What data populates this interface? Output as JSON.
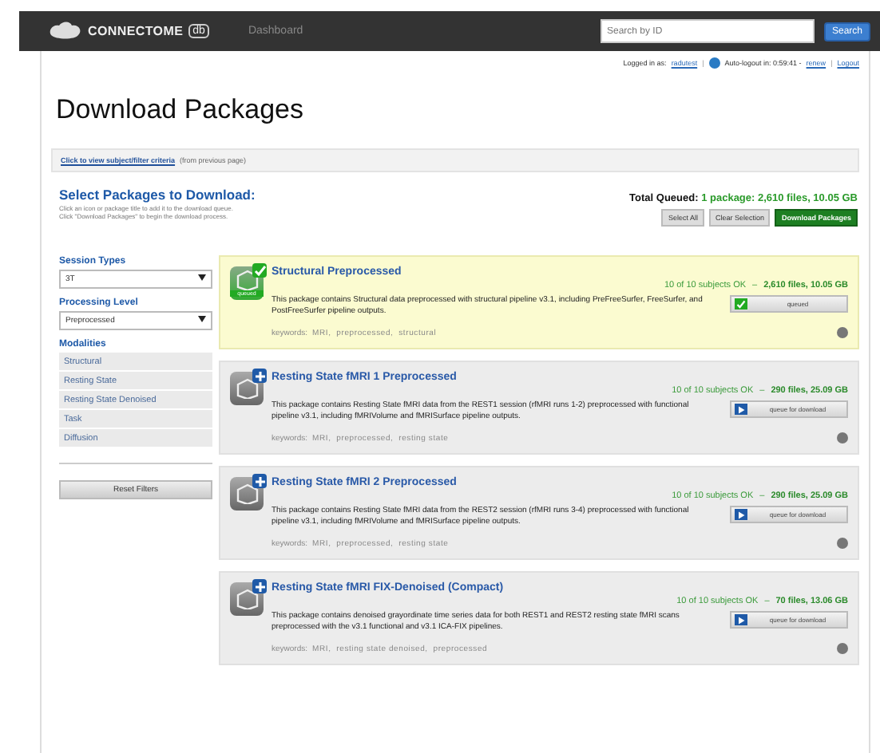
{
  "nav": {
    "logo": "CONNECTOME",
    "logo_badge": "db",
    "link": "Dashboard",
    "search": {
      "placeholder": "Search by ID"
    },
    "search_button": "Search"
  },
  "session": {
    "logged_in_label": "Logged in as:",
    "user": "radutest",
    "separator_1": "|",
    "separator_2": "|",
    "auto_logout": "Auto-logout in: 0:59:41 -",
    "renew": "renew",
    "logout": "Logout"
  },
  "title": "Download Packages",
  "filter_bar": {
    "link": "Click to view subject/filter criteria",
    "note": "(from previous page)"
  },
  "select": {
    "heading": "Select Packages to Download:",
    "hint_1": "Click an icon or package title to add it to the download queue.",
    "hint_2": "Click \"Download Packages\" to begin the download process.",
    "total_label": "Total Queued:",
    "total_value": "1 package: 2,610 files, 10.05 GB",
    "buttons": [
      {
        "label": "Select All",
        "kind": "plain"
      },
      {
        "label": "Clear Selection",
        "kind": "plain"
      },
      {
        "label": "Download Packages",
        "kind": "primary"
      }
    ]
  },
  "sidebar": {
    "session_types": {
      "label": "Session Types",
      "value": "3T"
    },
    "processing_level": {
      "label": "Processing Level",
      "value": "Preprocessed"
    },
    "modalities": {
      "label": "Modalities",
      "items": [
        "Structural",
        "Resting State",
        "Resting State Denoised",
        "Task",
        "Diffusion"
      ]
    },
    "reset": "Reset Filters"
  },
  "packages": [
    {
      "title": "Structural Preprocessed",
      "queued": true,
      "subjects": "10 of 10 subjects OK",
      "dash": "–",
      "size": "2,610 files, 10.05 GB",
      "description": "This package contains Structural data preprocessed with structural pipeline v3.1, including PreFreeSurfer, FreeSurfer, and PostFreeSurfer pipeline outputs.",
      "keywords_label": "keywords:",
      "keywords": "MRI,  preprocessed,  structural",
      "button": "queued",
      "icon_label": "queued"
    },
    {
      "title": "Resting State fMRI 1 Preprocessed",
      "queued": false,
      "subjects": "10 of 10 subjects OK",
      "dash": "–",
      "size": "290 files, 25.09 GB",
      "description": "This package contains Resting State fMRI data from the REST1 session (rfMRI runs 1-2) preprocessed with functional pipeline v3.1, including fMRIVolume and fMRISurface pipeline outputs.",
      "keywords_label": "keywords:",
      "keywords": "MRI,  preprocessed,  resting state",
      "button": "queue for download"
    },
    {
      "title": "Resting State fMRI 2 Preprocessed",
      "queued": false,
      "subjects": "10 of 10 subjects OK",
      "dash": "–",
      "size": "290 files, 25.09 GB",
      "description": "This package contains Resting State fMRI data from the REST2 session (rfMRI runs 3-4) preprocessed with functional pipeline v3.1, including fMRIVolume and fMRISurface pipeline outputs.",
      "keywords_label": "keywords:",
      "keywords": "MRI,  preprocessed,  resting state",
      "button": "queue for download"
    },
    {
      "title": "Resting State fMRI FIX-Denoised (Compact)",
      "queued": false,
      "subjects": "10 of 10 subjects OK",
      "dash": "–",
      "size": "70 files, 13.06 GB",
      "description": "This package contains denoised grayordinate time series data for both REST1 and REST2 resting state fMRI scans preprocessed with the v3.1 functional and v3.1 ICA-FIX pipelines.",
      "keywords_label": "keywords:",
      "keywords": "MRI,  resting state denoised,  preprocessed",
      "button": "queue for download"
    }
  ]
}
